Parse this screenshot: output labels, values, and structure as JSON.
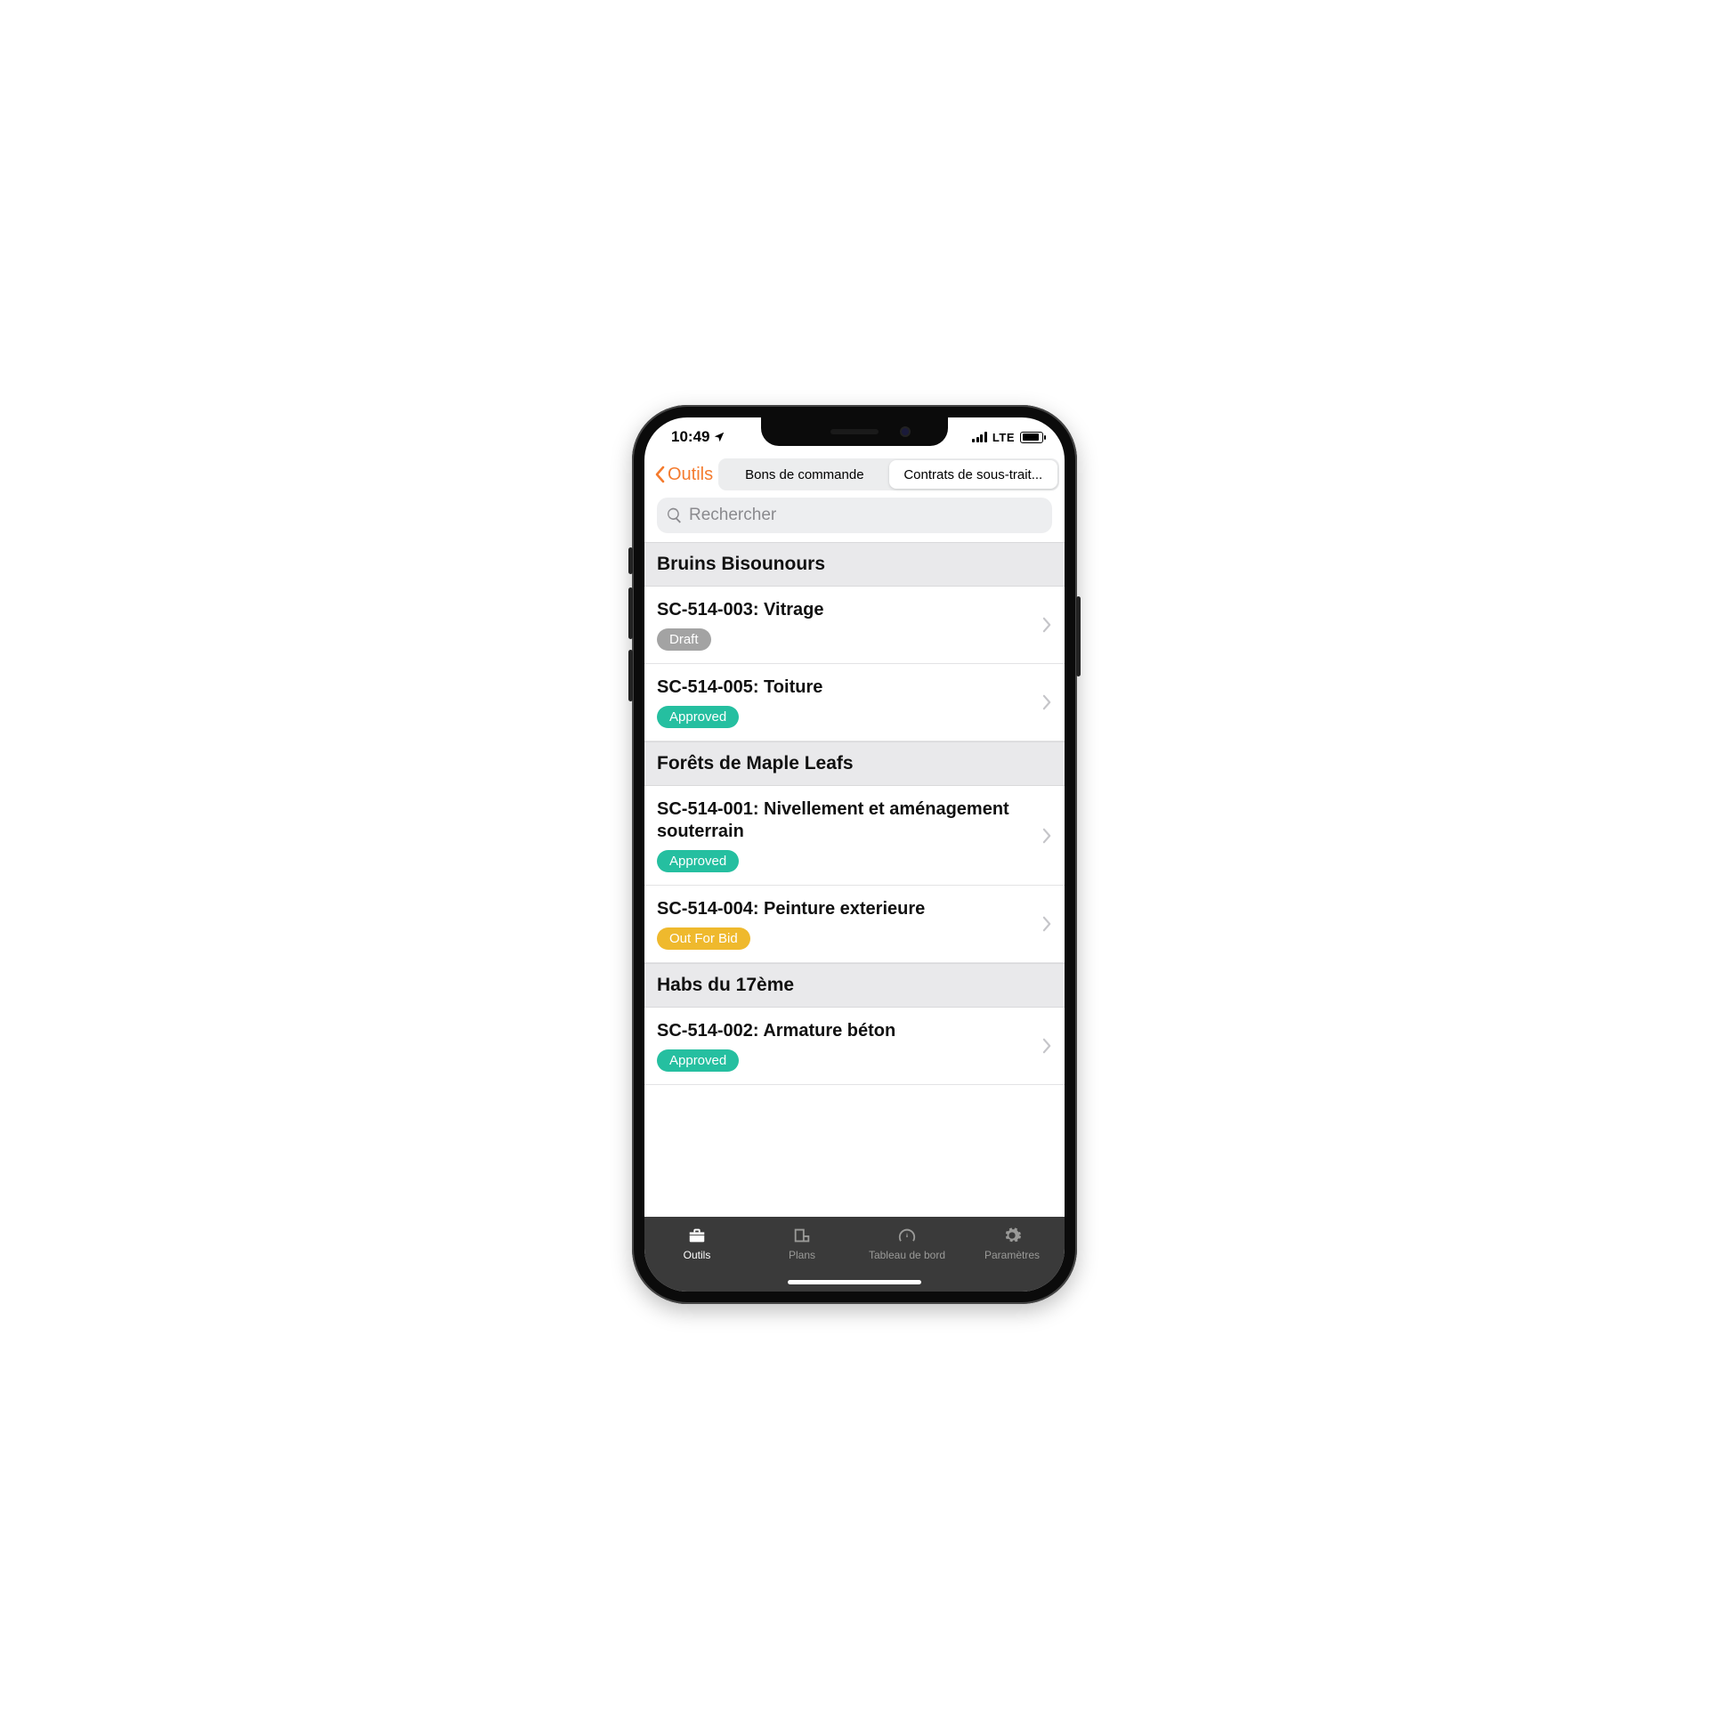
{
  "status": {
    "time": "10:49",
    "network_label": "LTE"
  },
  "nav": {
    "back_label": "Outils",
    "segments": {
      "po": "Bons de commande",
      "subcontracts": "Contrats de sous-trait..."
    }
  },
  "search": {
    "placeholder": "Rechercher"
  },
  "colors": {
    "accent": "#f47b2e",
    "status_draft": "#a3a3a3",
    "status_approved": "#25bfa0",
    "status_out_for_bid": "#efb92d"
  },
  "sections": [
    {
      "title": "Bruins Bisounours",
      "items": [
        {
          "title": "SC-514-003: Vitrage",
          "status_label": "Draft",
          "status_kind": "draft"
        },
        {
          "title": "SC-514-005: Toiture",
          "status_label": "Approved",
          "status_kind": "approved"
        }
      ]
    },
    {
      "title": "Forêts de Maple Leafs",
      "items": [
        {
          "title": "SC-514-001: Nivellement et aménagement souterrain",
          "status_label": "Approved",
          "status_kind": "approved"
        },
        {
          "title": "SC-514-004: Peinture exterieure",
          "status_label": "Out For Bid",
          "status_kind": "out_for_bid"
        }
      ]
    },
    {
      "title": "Habs du 17ème",
      "items": [
        {
          "title": "SC-514-002: Armature béton",
          "status_label": "Approved",
          "status_kind": "approved"
        }
      ]
    }
  ],
  "tabs": {
    "tools": "Outils",
    "plans": "Plans",
    "dashboard": "Tableau de bord",
    "settings": "Paramètres"
  }
}
